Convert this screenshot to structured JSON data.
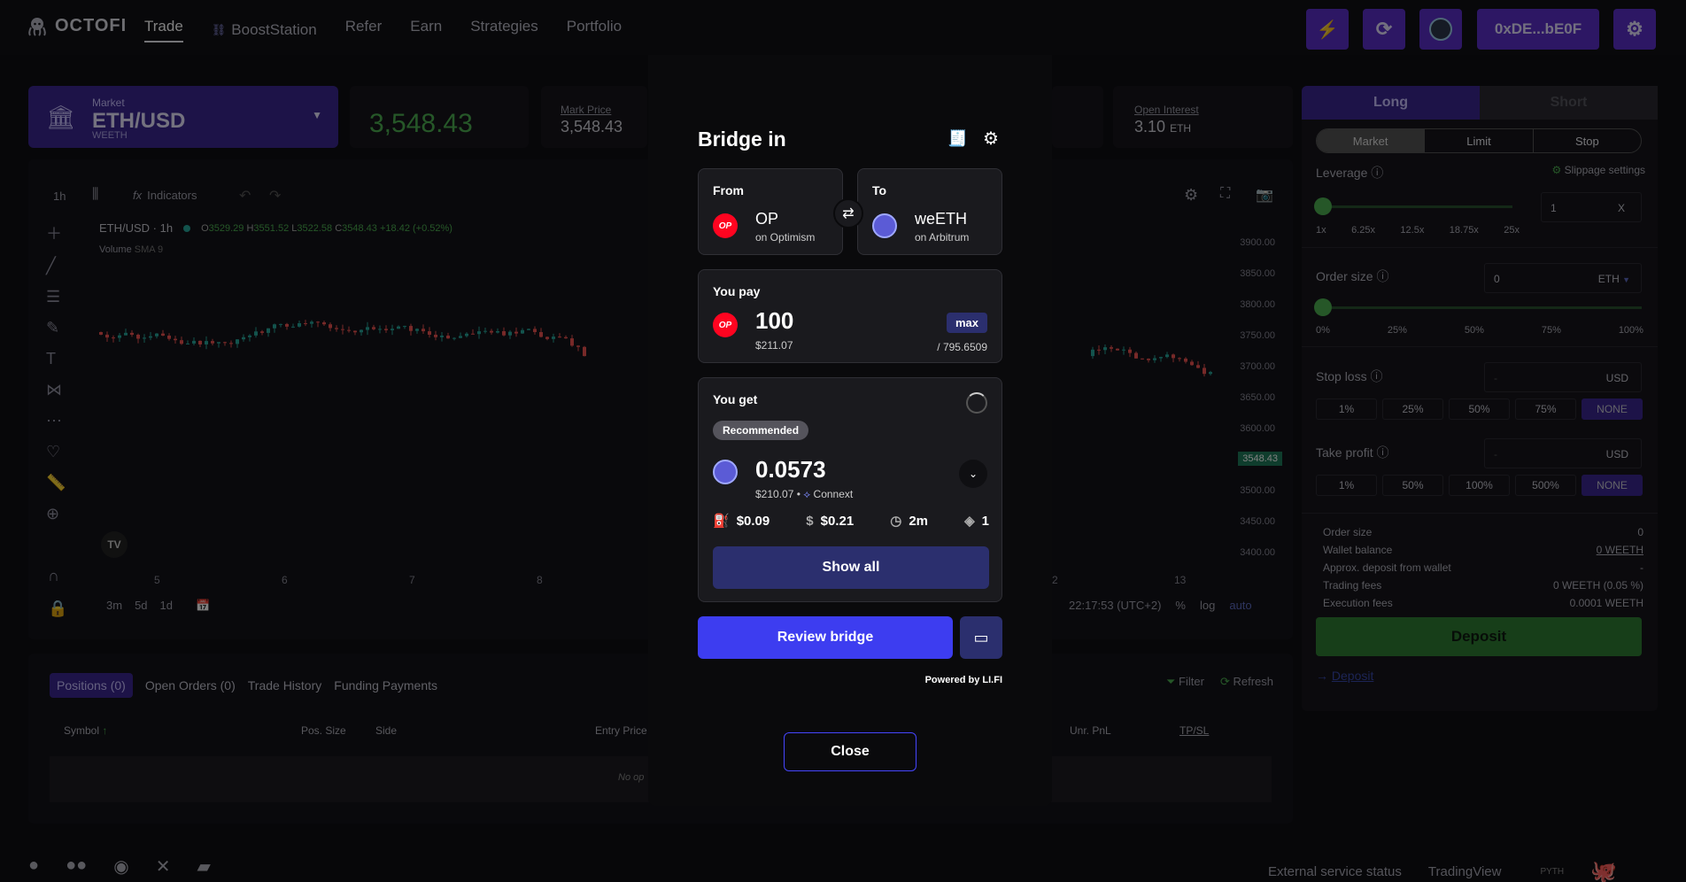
{
  "brand": "OCTOFI",
  "nav": {
    "trade": "Trade",
    "boost": "BoostStation",
    "refer": "Refer",
    "earn": "Earn",
    "strategies": "Strategies",
    "portfolio": "Portfolio"
  },
  "wallet": "0xDE...bE0F",
  "market": {
    "label": "Market",
    "pair": "ETH/USD",
    "sub": "WEETH"
  },
  "price": "3,548.43",
  "mark": {
    "label": "Mark Price",
    "value": "3,548.43"
  },
  "oi": {
    "label": "Open Interest",
    "value": "3.10",
    "unit": "ETH"
  },
  "chart": {
    "interval": "1h",
    "indicators": "Indicators",
    "legend_pair": "ETH/USD · 1h",
    "ohlc": {
      "o": "O",
      "ov": "3529.29",
      "h": "H",
      "hv": "3551.52",
      "l": "L",
      "lv": "3522.58",
      "c": "C",
      "cv": "3548.43",
      "chg": "+18.42 (+0.52%)"
    },
    "volume": "Volume",
    "sma": "SMA 9",
    "yticks": [
      "3900.00",
      "3850.00",
      "3800.00",
      "3750.00",
      "3700.00",
      "3650.00",
      "3600.00",
      "3550.00",
      "3500.00",
      "3450.00",
      "3400.00"
    ],
    "price_tag": "3548.43",
    "xticks": [
      "5",
      "6",
      "7",
      "8",
      "2",
      "13"
    ],
    "ranges": [
      "3m",
      "5d",
      "1d"
    ],
    "time": "22:17:53 (UTC+2)",
    "pct": "%",
    "log": "log",
    "auto": "auto"
  },
  "tabs": {
    "positions": "Positions (0)",
    "orders": "Open Orders (0)",
    "history": "Trade History",
    "funding": "Funding Payments",
    "filter": "Filter",
    "refresh": "Refresh"
  },
  "table": {
    "symbol": "Symbol",
    "size": "Pos. Size",
    "side": "Side",
    "entry": "Entry Price",
    "pnl": "Unr. PnL",
    "tpsl": "TP/SL",
    "empty_left": "No op"
  },
  "right": {
    "long": "Long",
    "short": "Short",
    "otype": [
      "Market",
      "Limit",
      "Stop"
    ],
    "leverage": "Leverage",
    "slippage": "Slippage settings",
    "lev_val": "1",
    "lev_x": "X",
    "lev_marks": [
      "1x",
      "6.25x",
      "12.5x",
      "18.75x",
      "25x"
    ],
    "order_size": "Order size",
    "os_val": "0",
    "os_unit": "ETH",
    "os_marks": [
      "0%",
      "25%",
      "50%",
      "75%",
      "100%"
    ],
    "stop_loss": "Stop loss",
    "sl_ph": "-",
    "usd": "USD",
    "sl_opts": [
      "1%",
      "25%",
      "50%",
      "75%",
      "NONE"
    ],
    "take_profit": "Take profit",
    "tp_opts": [
      "1%",
      "50%",
      "100%",
      "500%",
      "NONE"
    ],
    "summary": [
      {
        "k": "Order size",
        "v": "0"
      },
      {
        "k": "Wallet balance",
        "v": "0 WEETH"
      },
      {
        "k": "Approx. deposit from wallet",
        "v": "-"
      },
      {
        "k": "Trading fees",
        "v": "0 WEETH (0.05 %)"
      },
      {
        "k": "Execution fees",
        "v": "0.0001 WEETH"
      }
    ],
    "deposit_btn": "Deposit",
    "deposit_link": "Deposit"
  },
  "footer": {
    "status": "External service status",
    "tv": "TradingView",
    "pyth": "PYTH"
  },
  "modal": {
    "title": "Bridge in",
    "from": {
      "label": "From",
      "token": "OP",
      "chain": "on Optimism"
    },
    "to": {
      "label": "To",
      "token": "weETH",
      "chain": "on Arbitrum"
    },
    "pay": {
      "label": "You pay",
      "amount": "100",
      "usd": "$211.07",
      "max": "max",
      "balance": "/ 795.6509"
    },
    "get": {
      "label": "You get",
      "badge": "Recommended",
      "amount": "0.0573",
      "usd": "$210.07",
      "via": "Connext",
      "gas": "$0.09",
      "fee": "$0.21",
      "time": "2m",
      "steps": "1"
    },
    "show_all": "Show all",
    "review": "Review bridge",
    "powered": "Powered by",
    "lifi": "LI.FI",
    "close": "Close"
  }
}
